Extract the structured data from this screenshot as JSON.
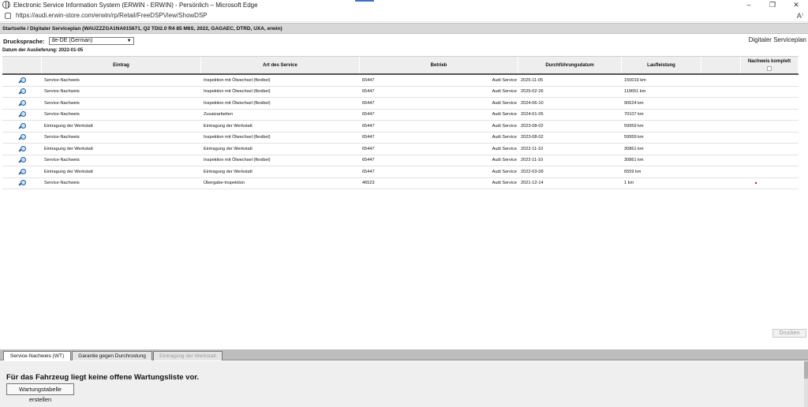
{
  "window": {
    "title": "Electronic Service Information System (ERWIN - ERWIN) - Persönlich – Microsoft Edge",
    "url": "https://audi.erwin-store.com/erwin/rp/Retail/FreeDSPView/ShowDSP",
    "controls": {
      "minimize": "–",
      "maximize": "❐",
      "close": "✕"
    },
    "read_aloud": "A⁾"
  },
  "breadcrumb": "Startseite / Digitaler Serviceplan (WAUZZZGA1NA015671, Q2 TDI2.0 R4 85 M6S, 2022, GAGAEC, DTRD, UXA, erwin)",
  "print_language": {
    "label": "Drucksprache:",
    "selected": "de-DE (German)"
  },
  "page_heading": "Digitaler Serviceplan",
  "delivery_date": "Datum der Auslieferung: 2022-01-05",
  "table": {
    "headers": {
      "eintrag": "Eintrag",
      "art": "Art des Service",
      "betrieb": "Betrieb",
      "datum": "Durchführungsdatum",
      "laufleistung": "Laufleistung",
      "blank": "",
      "nachweis": "Nachweis komplett"
    },
    "rows": [
      {
        "eintrag": "Service-Nachweis",
        "art": "Inspektion mit Ölwechsel (flexibel)",
        "betrieb_nr": "65447",
        "betrieb_name": "Audi Service",
        "datum": "2025-11-05",
        "laufleistung": "150019 km"
      },
      {
        "eintrag": "Service-Nachweis",
        "art": "Inspektion mit Ölwechsel (flexibel)",
        "betrieb_nr": "65447",
        "betrieb_name": "Audi Service",
        "datum": "2025-02-26",
        "laufleistung": "119651 km"
      },
      {
        "eintrag": "Service-Nachweis",
        "art": "Inspektion mit Ölwechsel (flexibel)",
        "betrieb_nr": "65447",
        "betrieb_name": "Audi Service",
        "datum": "2024-06-10",
        "laufleistung": "90624 km"
      },
      {
        "eintrag": "Service-Nachweis",
        "art": "Zusatzarbeiten",
        "betrieb_nr": "65447",
        "betrieb_name": "Audi Service",
        "datum": "2024-01-05",
        "laufleistung": "70107 km"
      },
      {
        "eintrag": "Eintragung der Werkstatt",
        "art": "Eintragung der Werkstatt",
        "betrieb_nr": "65447",
        "betrieb_name": "Audi Service",
        "datum": "2023-08-02",
        "laufleistung": "59959 km"
      },
      {
        "eintrag": "Service-Nachweis",
        "art": "Inspektion mit Ölwechsel (flexibel)",
        "betrieb_nr": "65447",
        "betrieb_name": "Audi Service",
        "datum": "2023-08-02",
        "laufleistung": "59959 km"
      },
      {
        "eintrag": "Eintragung der Werkstatt",
        "art": "Eintragung der Werkstatt",
        "betrieb_nr": "65447",
        "betrieb_name": "Audi Service",
        "datum": "2022-11-10",
        "laufleistung": "30861 km"
      },
      {
        "eintrag": "Service-Nachweis",
        "art": "Inspektion mit Ölwechsel (flexibel)",
        "betrieb_nr": "65447",
        "betrieb_name": "Audi Service",
        "datum": "2022-11-10",
        "laufleistung": "30861 km"
      },
      {
        "eintrag": "Eintragung der Werkstatt",
        "art": "Eintragung der Werkstatt",
        "betrieb_nr": "65447",
        "betrieb_name": "Audi Service",
        "datum": "2022-03-09",
        "laufleistung": "6559 km"
      },
      {
        "eintrag": "Service-Nachweis",
        "art": "Übergabe-Inspektion",
        "betrieb_nr": "46523",
        "betrieb_name": "Audi Service",
        "datum": "2021-12-14",
        "laufleistung": "1 km",
        "red_marker": true
      }
    ]
  },
  "print_button": "Drucken",
  "tabs": [
    {
      "label": "Service-Nachweis (WT)",
      "state": "active"
    },
    {
      "label": "Garantie gegen Durchrostung",
      "state": "normal"
    },
    {
      "label": "Eintragung der Werkstatt",
      "state": "disabled"
    }
  ],
  "bottom_panel": {
    "message": "Für das Fahrzeug liegt keine offene Wartungsliste vor.",
    "create_button": "Wartungstabelle erstellen"
  },
  "colors": {
    "magnifier_icon": "#1c5b9b",
    "header_bg": "#eeeeee",
    "tabbar_bg": "#bdbdbd",
    "red_marker": "#dd0000"
  }
}
